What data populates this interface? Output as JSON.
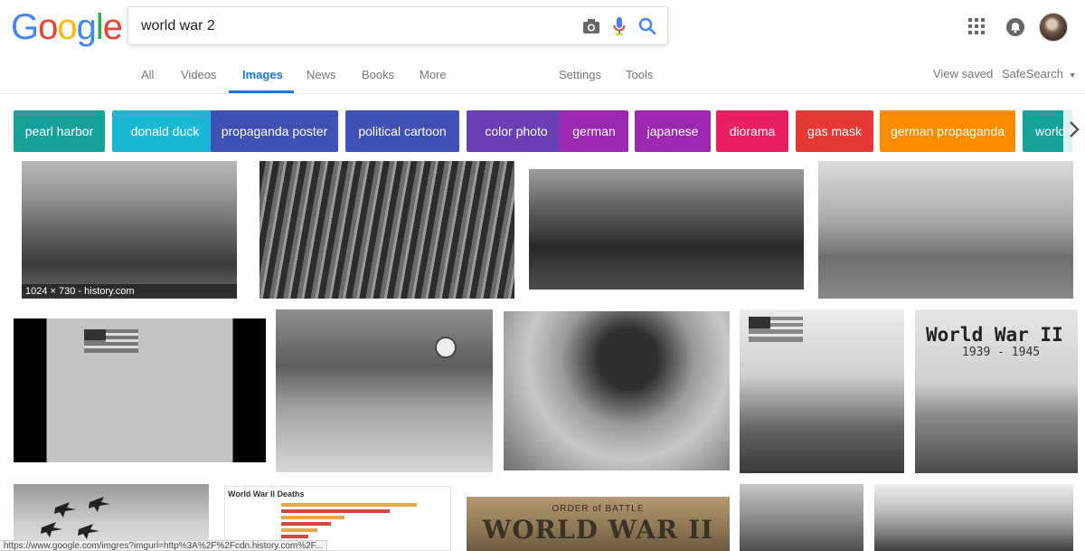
{
  "logo": {
    "text": "Google",
    "letters": [
      "G",
      "o",
      "o",
      "g",
      "l",
      "e"
    ],
    "colors": [
      "#4285F4",
      "#EA4335",
      "#FBBC05",
      "#4285F4",
      "#34A853",
      "#EA4335"
    ]
  },
  "search": {
    "value": "world war 2",
    "icons": [
      "camera-icon",
      "microphone-icon",
      "search-icon"
    ]
  },
  "header": {
    "icons": [
      "apps-grid-icon",
      "notifications-icon",
      "account-avatar"
    ]
  },
  "nav": {
    "tabs": [
      {
        "label": "All"
      },
      {
        "label": "Videos"
      },
      {
        "label": "Images",
        "active": true
      },
      {
        "label": "News"
      },
      {
        "label": "Books"
      },
      {
        "label": "More"
      }
    ],
    "settings": "Settings",
    "tools": "Tools",
    "view_saved": "View saved",
    "safesearch": "SafeSearch",
    "accent": "#1a73e8"
  },
  "chips": [
    {
      "label": "pearl harbor",
      "color": "#16a19a"
    },
    {
      "label": "donald duck",
      "color": "#1bb8d6"
    },
    {
      "label": "propaganda poster",
      "color": "#3f51b5"
    },
    {
      "label": "political cartoon",
      "color": "#3f51b5"
    },
    {
      "label": "color photo",
      "color": "#6a3fb6"
    },
    {
      "label": "german",
      "color": "#9c27b0"
    },
    {
      "label": "japanese",
      "color": "#9c27b0"
    },
    {
      "label": "diorama",
      "color": "#e91e63"
    },
    {
      "label": "gas mask",
      "color": "#e53935"
    },
    {
      "label": "german propaganda",
      "color": "#fb8c00"
    },
    {
      "label": "world war",
      "color": "#16a19a"
    }
  ],
  "results": {
    "caption": "1024 × 730 - history.com",
    "poster_title": "World War II",
    "poster_years": "1939 - 1945",
    "chart_title": "World War II Deaths",
    "game_subtitle": "ORDER of BATTLE",
    "game_title": "WORLD WAR II"
  },
  "status_url": "https://www.google.com/imgres?imgurl=http%3A%2F%2Fcdn.history.com%2F..."
}
